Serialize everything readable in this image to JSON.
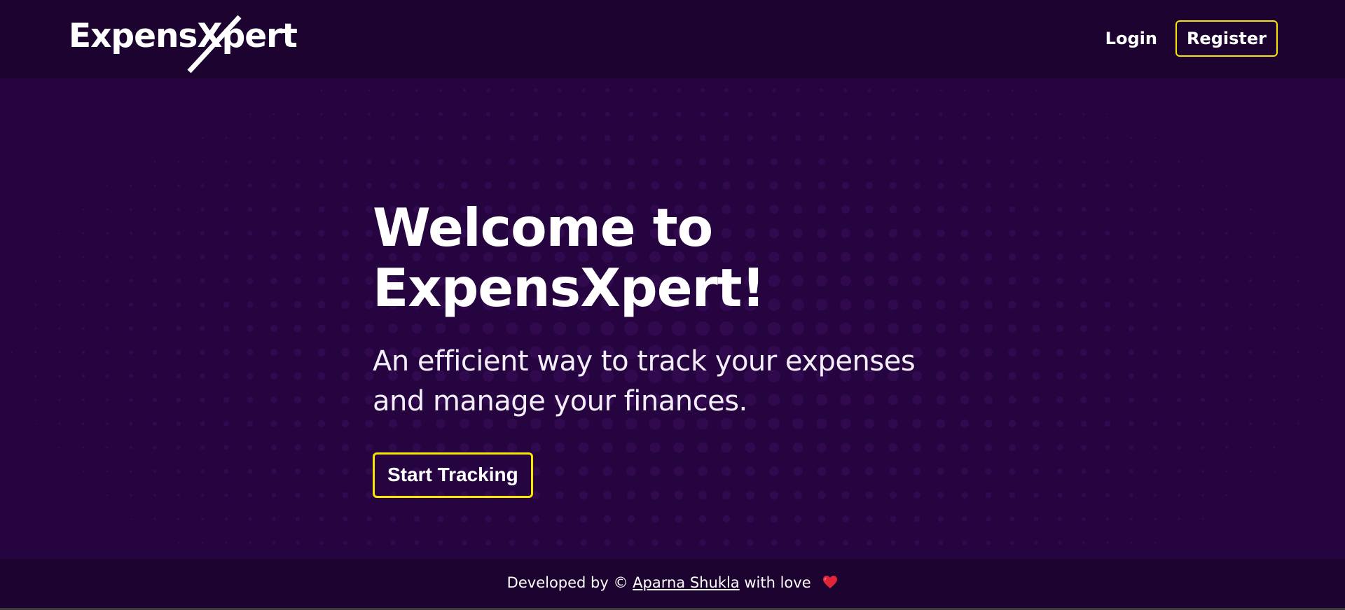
{
  "header": {
    "logo_text": "ExpensXpert",
    "nav": {
      "login_label": "Login",
      "register_label": "Register"
    }
  },
  "hero": {
    "title_line1": "Welcome to",
    "title_line2": "ExpensXpert!",
    "subtitle": "An efficient way to track your expenses and manage your finances.",
    "cta_label": "Start Tracking"
  },
  "footer": {
    "prefix": "Developed by ©",
    "author": "Aparna Shukla",
    "suffix": "with love",
    "heart_icon": "heart-icon"
  },
  "colors": {
    "background": "#250440",
    "header_background": "#1c0330",
    "accent_border": "#f6e600",
    "text": "#ffffff",
    "heart": "#e0243a"
  }
}
